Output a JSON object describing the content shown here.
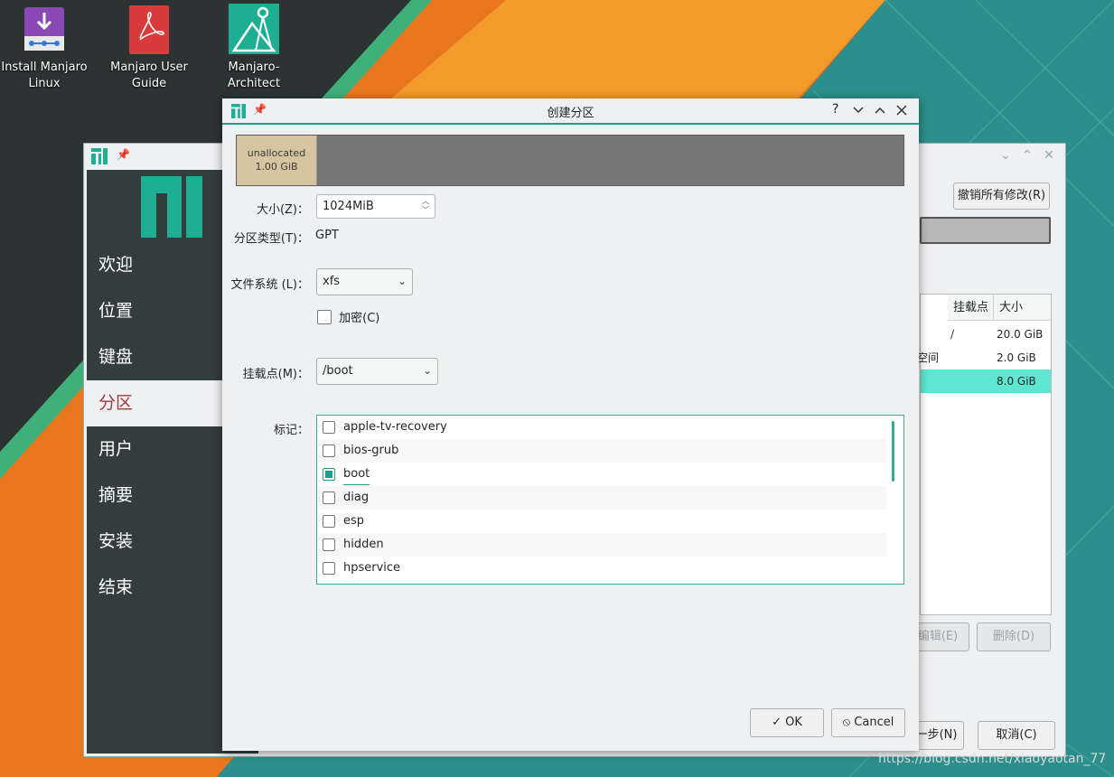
{
  "desktop": {
    "icons": [
      {
        "label": "Install Manjaro Linux"
      },
      {
        "label": "Manjaro User Guide"
      },
      {
        "label": "Manjaro-Architect"
      }
    ],
    "watermark": "https://blog.csdn.net/xiaoyaotan_77"
  },
  "installer": {
    "sidebar": [
      "欢迎",
      "位置",
      "键盘",
      "分区",
      "用户",
      "摘要",
      "安装",
      "结束"
    ],
    "revert_button": "撤销所有修改(R)",
    "table_headers": [
      "挂载点",
      "大小"
    ],
    "rows": [
      {
        "mount": "/",
        "size": "20.0 GiB"
      },
      {
        "mount": "空间",
        "size": "2.0 GiB"
      },
      {
        "mount": "",
        "size": "8.0 GiB"
      }
    ],
    "edit_button": "编辑(E)",
    "delete_button": "删除(D)",
    "next_button": "下一步(N)",
    "cancel_button": "取消(C)",
    "accent": "#1e9e8a"
  },
  "dialog": {
    "title": "创建分区",
    "unallocated": {
      "name": "unallocated",
      "size": "1.00 GiB"
    },
    "size_label": "大小(Z)：",
    "size_value": "1024MiB",
    "ptype_label": "分区类型(T)：",
    "ptype_value": "GPT",
    "fs_label": "文件系统 (L)：",
    "fs_value": "xfs",
    "encrypt_label": "加密(C)",
    "mount_label": "挂载点(M)：",
    "mount_value": "/boot",
    "flags_label": "标记：",
    "flags": [
      {
        "name": "apple-tv-recovery",
        "checked": false
      },
      {
        "name": "bios-grub",
        "checked": false
      },
      {
        "name": "boot",
        "checked": true
      },
      {
        "name": "diag",
        "checked": false
      },
      {
        "name": "esp",
        "checked": false
      },
      {
        "name": "hidden",
        "checked": false
      },
      {
        "name": "hpservice",
        "checked": false
      }
    ],
    "ok_button": "OK",
    "cancel_button": "Cancel"
  }
}
